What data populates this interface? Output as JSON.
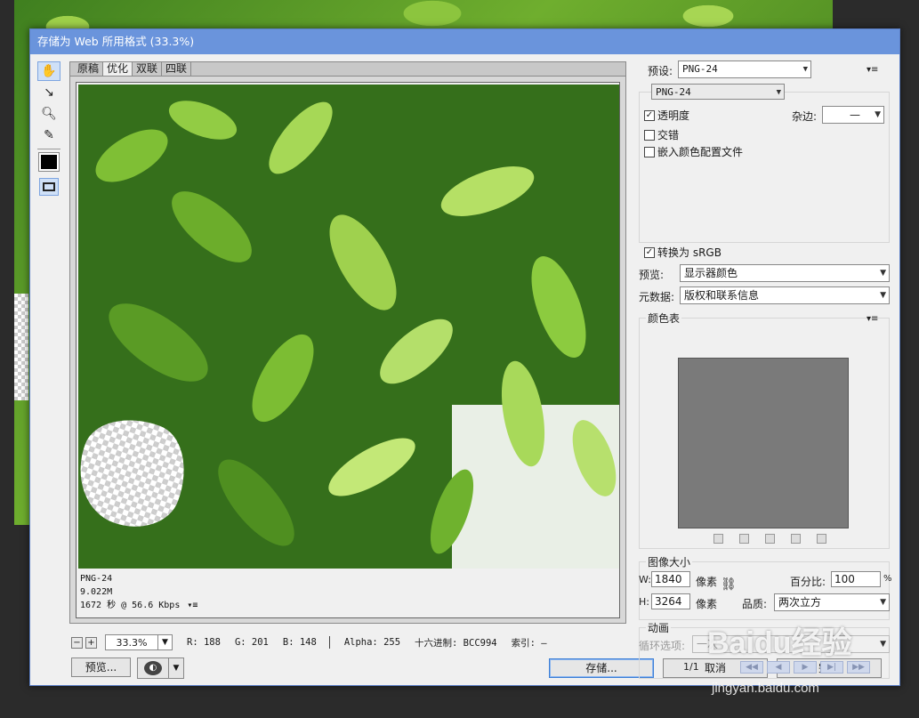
{
  "dialog": {
    "title": "存储为 Web 所用格式 (33.3%)"
  },
  "tabs": [
    {
      "label": "原稿",
      "active": false
    },
    {
      "label": "优化",
      "active": true
    },
    {
      "label": "双联",
      "active": false
    },
    {
      "label": "四联",
      "active": false
    }
  ],
  "image_info": {
    "format": "PNG-24",
    "size": "9.022M",
    "download_time": "1672 秒 @ 56.6 Kbps",
    "menu_icon": "▾≡"
  },
  "status": {
    "zoom": "33.3%",
    "r": "R: 188",
    "g": "G: 201",
    "b": "B: 148",
    "alpha": "Alpha: 255",
    "hex": "十六进制: BCC994",
    "index": "索引: —"
  },
  "buttons": {
    "preview": "预览...",
    "save": "存储...",
    "cancel": "取消",
    "done": "完成"
  },
  "settings": {
    "preset_label": "预设:",
    "preset_value": "PNG-24",
    "format_value": "PNG-24",
    "transparency_label": "透明度",
    "transparency_checked": true,
    "matte_label": "杂边:",
    "matte_value": "—",
    "interlaced_label": "交错",
    "interlaced_checked": false,
    "embed_profile_label": "嵌入颜色配置文件",
    "embed_profile_checked": false,
    "convert_srgb_label": "转换为 sRGB",
    "convert_srgb_checked": true,
    "preview_label": "预览:",
    "preview_value": "显示器颜色",
    "metadata_label": "元数据:",
    "metadata_value": "版权和联系信息"
  },
  "color_table": {
    "label": "颜色表",
    "fill": "#7a7a7a"
  },
  "image_size": {
    "label": "图像大小",
    "w_label": "W:",
    "width": "1840",
    "h_label": "H:",
    "height": "3264",
    "unit": "像素",
    "percent_label": "百分比:",
    "percent": "100",
    "percent_unit": "%",
    "quality_label": "品质:",
    "quality_value": "两次立方"
  },
  "animation": {
    "label": "动画",
    "loop_label": "循环选项:",
    "loop_value": "一次",
    "frame": "1/1"
  },
  "watermark": {
    "brand": "Baidu经验",
    "site": "jingyan.baidu.com"
  },
  "colors": {
    "title_bar": "#6a94dc",
    "dialog_bg": "#f0f0f0",
    "accent": "#3c7fd6"
  }
}
